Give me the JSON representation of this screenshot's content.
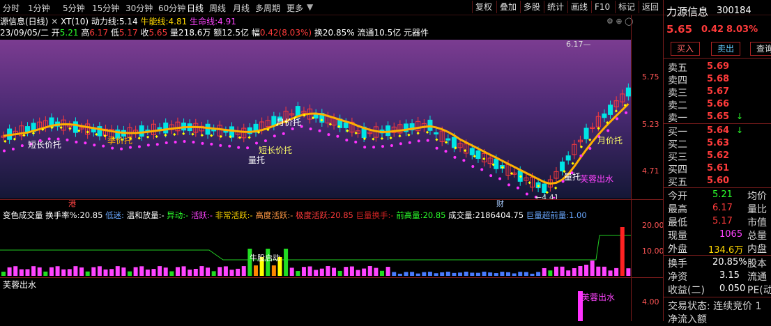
{
  "menu": {
    "left_items": [
      "分时",
      "1分钟",
      "5分钟",
      "15分钟",
      "30分钟",
      "60分钟",
      "日线",
      "周线",
      "月线",
      "多周期",
      "更多"
    ],
    "right_items": [
      "复权",
      "叠加",
      "多股",
      "统计",
      "画线",
      "F10",
      "标记",
      "返回"
    ]
  },
  "chart_header": {
    "title": "源信息(日线)",
    "indicator": "XT(10)",
    "dongli_label": "动力线:",
    "dongli_value": "5.14",
    "niuneng_label": "牛能线:",
    "niuneng_value": "4.81",
    "shengming_label": "生命线:",
    "shengming_value": "4.91"
  },
  "quote_line": {
    "date": "23/09/05/二",
    "open_label": "开",
    "open": "5.21",
    "high_label": "高",
    "high": "6.17",
    "low_label": "低",
    "low": "5.17",
    "close_label": "收",
    "close": "5.65",
    "vol_label": "量",
    "volume": "218.6万",
    "amount_label": "额",
    "amount": "12.5亿",
    "change_label": "幅",
    "change": "0.42(8.03%)",
    "turnover_label": "换",
    "turnover": "20.85%",
    "float_label": "流通",
    "float": "10.5亿",
    "sector": "元器件"
  },
  "main_chart": {
    "y_ticks": [
      "5.75",
      "5.23",
      "4.71"
    ],
    "annotations": {
      "high": "6.17",
      "low": "4.41",
      "duanchang1": "短长价托",
      "jijia": "季价托",
      "duanchang2": "短长价托",
      "yuejia1": "月价托",
      "liangtuo1": "量托",
      "liangtuo2": "量托",
      "yuejia2": "月价托",
      "furong": "芙蓉出水",
      "gang": "港",
      "cai": "财"
    }
  },
  "volume_header": {
    "name": "变色成交量",
    "turnover_label": "换手率%:",
    "turnover_value": "20.85",
    "low_label": "低迷:",
    "mild_label": "温和放量:",
    "abnormal_label": "异动:",
    "active_label": "活跃:",
    "very_active_label": "非常活跃:",
    "high_active_label": "高度活跃:",
    "extreme_label": "极度活跃:",
    "extreme_value": "20.85",
    "huge_label": "巨量换手:",
    "prev_high_label": "前高量:",
    "prev_high_value": "20.85",
    "vol_label": "成交量:",
    "vol_value": "2186404.75",
    "record_label": "巨量超前量:",
    "record_value": "1.00",
    "dash": "-",
    "niugu": "牛股启动"
  },
  "volume_chart": {
    "y_ticks": [
      "20.00",
      "10.00"
    ]
  },
  "bottom_panel": {
    "name": "芙蓉出水",
    "tag": "芙蓉出水",
    "y_ticks": [
      "4.00"
    ]
  },
  "right_panel": {
    "stock_name": "力源信息",
    "stock_code": "300184",
    "price": "5.65",
    "change": "0.42",
    "change_pct": "8.03%",
    "buttons": [
      "买入",
      "卖出",
      "查询"
    ],
    "sell": [
      {
        "label": "卖五",
        "price": "5.69"
      },
      {
        "label": "卖四",
        "price": "5.68"
      },
      {
        "label": "卖三",
        "price": "5.67"
      },
      {
        "label": "卖二",
        "price": "5.66"
      },
      {
        "label": "卖一",
        "price": "5.65"
      }
    ],
    "buy": [
      {
        "label": "买一",
        "price": "5.64"
      },
      {
        "label": "买二",
        "price": "5.63"
      },
      {
        "label": "买三",
        "price": "5.62"
      },
      {
        "label": "买四",
        "price": "5.61"
      },
      {
        "label": "买五",
        "price": "5.60"
      }
    ],
    "stats": [
      {
        "label": "今开",
        "value": "5.21",
        "extra": "均价"
      },
      {
        "label": "最高",
        "value": "6.17",
        "extra": "量比"
      },
      {
        "label": "最低",
        "value": "5.17",
        "extra": "市值"
      },
      {
        "label": "现量",
        "value": "1065",
        "extra": "总量"
      },
      {
        "label": "外盘",
        "value": "134.6万",
        "extra": "内盘"
      },
      {
        "label": "换手",
        "value": "20.85%",
        "extra": "股本"
      },
      {
        "label": "净资",
        "value": "3.15",
        "extra": "流通"
      },
      {
        "label": "收益(二)",
        "value": "0.050",
        "extra": "PE(动"
      }
    ],
    "trade_status": "交易状态: 连续竞价 1",
    "net_inflow": "净流入额"
  },
  "colors": {
    "up": "#ff3b3b",
    "down": "#00e5e5",
    "ma_yellow": "#ffb000",
    "dot_yellow": "#ffff00",
    "dot_magenta": "#ff33ff"
  }
}
